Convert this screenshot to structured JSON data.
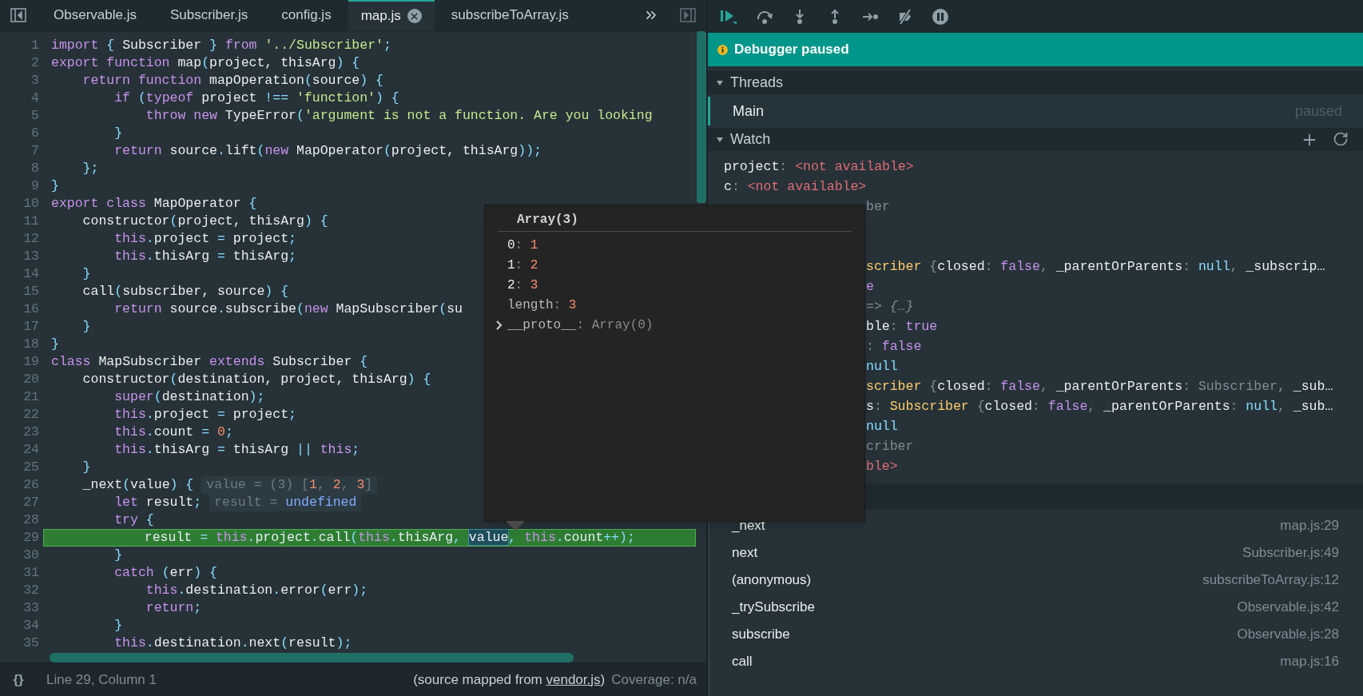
{
  "editor": {
    "tabs": [
      {
        "label": "Observable.js",
        "selected": false
      },
      {
        "label": "Subscriber.js",
        "selected": false
      },
      {
        "label": "config.js",
        "selected": false
      },
      {
        "label": "map.js",
        "selected": true
      },
      {
        "label": "subscribeToArray.js",
        "selected": false
      }
    ],
    "lines": [
      {
        "number": "1",
        "current": false,
        "tokens": [
          {
            "t": "import",
            "kind": "k"
          },
          {
            "t": " { ",
            "kind": "p"
          },
          {
            "t": "Subscriber",
            "kind": "i"
          },
          {
            "t": " } ",
            "kind": "p"
          },
          {
            "t": "from ",
            "kind": "k"
          },
          {
            "t": "'../Subscriber'",
            "kind": "s"
          },
          {
            "t": ";",
            "kind": "p"
          }
        ]
      },
      {
        "number": "2",
        "current": false,
        "tokens": [
          {
            "t": "export function ",
            "kind": "k"
          },
          {
            "t": "map",
            "kind": "i"
          },
          {
            "t": "(",
            "kind": "p"
          },
          {
            "t": "project, thisArg",
            "kind": "i"
          },
          {
            "t": ") {",
            "kind": "p"
          }
        ]
      },
      {
        "number": "3",
        "current": false,
        "tokens": [
          {
            "t": "    return function ",
            "kind": "k"
          },
          {
            "t": "mapOperation",
            "kind": "i"
          },
          {
            "t": "(",
            "kind": "p"
          },
          {
            "t": "source",
            "kind": "i"
          },
          {
            "t": ") {",
            "kind": "p"
          }
        ]
      },
      {
        "number": "4",
        "current": false,
        "tokens": [
          {
            "t": "        if ",
            "kind": "k"
          },
          {
            "t": "(",
            "kind": "p"
          },
          {
            "t": "typeof ",
            "kind": "k"
          },
          {
            "t": "project ",
            "kind": "i"
          },
          {
            "t": "!== ",
            "kind": "p"
          },
          {
            "t": "'function'",
            "kind": "s"
          },
          {
            "t": ") {",
            "kind": "p"
          }
        ]
      },
      {
        "number": "5",
        "current": false,
        "tokens": [
          {
            "t": "            throw new ",
            "kind": "k"
          },
          {
            "t": "TypeError",
            "kind": "i"
          },
          {
            "t": "(",
            "kind": "p"
          },
          {
            "t": "'argument is not a function. Are you looking",
            "kind": "s"
          }
        ]
      },
      {
        "number": "6",
        "current": false,
        "tokens": [
          {
            "t": "        }",
            "kind": "p"
          }
        ]
      },
      {
        "number": "7",
        "current": false,
        "tokens": [
          {
            "t": "        return ",
            "kind": "k"
          },
          {
            "t": "source",
            "kind": "i"
          },
          {
            "t": ".",
            "kind": "p"
          },
          {
            "t": "lift",
            "kind": "i"
          },
          {
            "t": "(",
            "kind": "p"
          },
          {
            "t": "new ",
            "kind": "k"
          },
          {
            "t": "MapOperator",
            "kind": "i"
          },
          {
            "t": "(",
            "kind": "p"
          },
          {
            "t": "project, thisArg",
            "kind": "i"
          },
          {
            "t": "));",
            "kind": "p"
          }
        ]
      },
      {
        "number": "8",
        "current": false,
        "tokens": [
          {
            "t": "    };",
            "kind": "p"
          }
        ]
      },
      {
        "number": "9",
        "current": false,
        "tokens": [
          {
            "t": "}",
            "kind": "p"
          }
        ]
      },
      {
        "number": "10",
        "current": false,
        "tokens": [
          {
            "t": "export class ",
            "kind": "k"
          },
          {
            "t": "MapOperator ",
            "kind": "i"
          },
          {
            "t": "{",
            "kind": "p"
          }
        ]
      },
      {
        "number": "11",
        "current": false,
        "tokens": [
          {
            "t": "    constructor",
            "kind": "i"
          },
          {
            "t": "(",
            "kind": "p"
          },
          {
            "t": "project, thisArg",
            "kind": "i"
          },
          {
            "t": ") {",
            "kind": "p"
          }
        ]
      },
      {
        "number": "12",
        "current": false,
        "tokens": [
          {
            "t": "        this",
            "kind": "k"
          },
          {
            "t": ".",
            "kind": "p"
          },
          {
            "t": "project ",
            "kind": "i"
          },
          {
            "t": "= ",
            "kind": "p"
          },
          {
            "t": "project",
            "kind": "i"
          },
          {
            "t": ";",
            "kind": "p"
          }
        ]
      },
      {
        "number": "13",
        "current": false,
        "tokens": [
          {
            "t": "        this",
            "kind": "k"
          },
          {
            "t": ".",
            "kind": "p"
          },
          {
            "t": "thisArg ",
            "kind": "i"
          },
          {
            "t": "= ",
            "kind": "p"
          },
          {
            "t": "thisArg",
            "kind": "i"
          },
          {
            "t": ";",
            "kind": "p"
          }
        ]
      },
      {
        "number": "14",
        "current": false,
        "tokens": [
          {
            "t": "    }",
            "kind": "p"
          }
        ]
      },
      {
        "number": "15",
        "current": false,
        "tokens": [
          {
            "t": "    call",
            "kind": "i"
          },
          {
            "t": "(",
            "kind": "p"
          },
          {
            "t": "subscriber, source",
            "kind": "i"
          },
          {
            "t": ") {",
            "kind": "p"
          }
        ]
      },
      {
        "number": "16",
        "current": false,
        "tokens": [
          {
            "t": "        return ",
            "kind": "k"
          },
          {
            "t": "source",
            "kind": "i"
          },
          {
            "t": ".",
            "kind": "p"
          },
          {
            "t": "subscribe",
            "kind": "i"
          },
          {
            "t": "(",
            "kind": "p"
          },
          {
            "t": "new ",
            "kind": "k"
          },
          {
            "t": "MapSubscriber",
            "kind": "i"
          },
          {
            "t": "(",
            "kind": "p"
          },
          {
            "t": "su",
            "kind": "i"
          }
        ]
      },
      {
        "number": "17",
        "current": false,
        "tokens": [
          {
            "t": "    }",
            "kind": "p"
          }
        ]
      },
      {
        "number": "18",
        "current": false,
        "tokens": [
          {
            "t": "}",
            "kind": "p"
          }
        ]
      },
      {
        "number": "19",
        "current": false,
        "tokens": [
          {
            "t": "class ",
            "kind": "k"
          },
          {
            "t": "MapSubscriber ",
            "kind": "i"
          },
          {
            "t": "extends ",
            "kind": "k"
          },
          {
            "t": "Subscriber ",
            "kind": "i"
          },
          {
            "t": "{",
            "kind": "p"
          }
        ]
      },
      {
        "number": "20",
        "current": false,
        "tokens": [
          {
            "t": "    constructor",
            "kind": "i"
          },
          {
            "t": "(",
            "kind": "p"
          },
          {
            "t": "destination, project, thisArg",
            "kind": "i"
          },
          {
            "t": ") {",
            "kind": "p"
          }
        ]
      },
      {
        "number": "21",
        "current": false,
        "tokens": [
          {
            "t": "        super",
            "kind": "k"
          },
          {
            "t": "(",
            "kind": "p"
          },
          {
            "t": "destination",
            "kind": "i"
          },
          {
            "t": ");",
            "kind": "p"
          }
        ]
      },
      {
        "number": "22",
        "current": false,
        "tokens": [
          {
            "t": "        this",
            "kind": "k"
          },
          {
            "t": ".",
            "kind": "p"
          },
          {
            "t": "project ",
            "kind": "i"
          },
          {
            "t": "= ",
            "kind": "p"
          },
          {
            "t": "project",
            "kind": "i"
          },
          {
            "t": ";",
            "kind": "p"
          }
        ]
      },
      {
        "number": "23",
        "current": false,
        "tokens": [
          {
            "t": "        this",
            "kind": "k"
          },
          {
            "t": ".",
            "kind": "p"
          },
          {
            "t": "count ",
            "kind": "i"
          },
          {
            "t": "= ",
            "kind": "p"
          },
          {
            "t": "0",
            "kind": "n"
          },
          {
            "t": ";",
            "kind": "p"
          }
        ]
      },
      {
        "number": "24",
        "current": false,
        "tokens": [
          {
            "t": "        this",
            "kind": "k"
          },
          {
            "t": ".",
            "kind": "p"
          },
          {
            "t": "thisArg ",
            "kind": "i"
          },
          {
            "t": "= ",
            "kind": "p"
          },
          {
            "t": "thisArg ",
            "kind": "i"
          },
          {
            "t": "|| ",
            "kind": "p"
          },
          {
            "t": "this",
            "kind": "k"
          },
          {
            "t": ";",
            "kind": "p"
          }
        ]
      },
      {
        "number": "25",
        "current": false,
        "tokens": [
          {
            "t": "    }",
            "kind": "p"
          }
        ]
      },
      {
        "number": "26",
        "current": false,
        "tokens": [
          {
            "t": "    _next",
            "kind": "i"
          },
          {
            "t": "(",
            "kind": "p"
          },
          {
            "t": "value",
            "kind": "i"
          },
          {
            "t": ") {",
            "kind": "p"
          }
        ],
        "inline": [
          {
            "t": "value = (3) [",
            "kind": "g"
          },
          {
            "t": "1",
            "kind": "n"
          },
          {
            "t": ", ",
            "kind": "g"
          },
          {
            "t": "2",
            "kind": "n"
          },
          {
            "t": ", ",
            "kind": "g"
          },
          {
            "t": "3",
            "kind": "n"
          },
          {
            "t": "]",
            "kind": "g"
          }
        ]
      },
      {
        "number": "27",
        "current": false,
        "tokens": [
          {
            "t": "        let ",
            "kind": "k"
          },
          {
            "t": "result",
            "kind": "i"
          },
          {
            "t": ";",
            "kind": "p"
          }
        ],
        "inline": [
          {
            "t": "result = ",
            "kind": "g"
          },
          {
            "t": "undefined",
            "kind": "u"
          }
        ]
      },
      {
        "number": "28",
        "current": false,
        "tokens": [
          {
            "t": "        try ",
            "kind": "k"
          },
          {
            "t": "{",
            "kind": "p"
          }
        ]
      },
      {
        "number": "29",
        "current": true,
        "tokens": [
          {
            "t": "            result ",
            "kind": "i"
          },
          {
            "t": "= ",
            "kind": "p"
          },
          {
            "t": "this",
            "kind": "k"
          },
          {
            "t": ".",
            "kind": "p"
          },
          {
            "t": "project",
            "kind": "i"
          },
          {
            "t": ".",
            "kind": "p"
          },
          {
            "t": "call",
            "kind": "i"
          },
          {
            "t": "(",
            "kind": "p"
          },
          {
            "t": "this",
            "kind": "k"
          },
          {
            "t": ".",
            "kind": "p"
          },
          {
            "t": "thisArg",
            "kind": "i"
          },
          {
            "t": ", ",
            "kind": "p"
          },
          {
            "t": "value",
            "kind": "hl"
          },
          {
            "t": ", ",
            "kind": "p"
          },
          {
            "t": "this",
            "kind": "k"
          },
          {
            "t": ".",
            "kind": "p"
          },
          {
            "t": "count",
            "kind": "i"
          },
          {
            "t": "++);",
            "kind": "p"
          }
        ]
      },
      {
        "number": "30",
        "current": false,
        "tokens": [
          {
            "t": "        }",
            "kind": "p"
          }
        ]
      },
      {
        "number": "31",
        "current": false,
        "tokens": [
          {
            "t": "        catch ",
            "kind": "k"
          },
          {
            "t": "(",
            "kind": "p"
          },
          {
            "t": "err",
            "kind": "i"
          },
          {
            "t": ") {",
            "kind": "p"
          }
        ]
      },
      {
        "number": "32",
        "current": false,
        "tokens": [
          {
            "t": "            this",
            "kind": "k"
          },
          {
            "t": ".",
            "kind": "p"
          },
          {
            "t": "destination",
            "kind": "i"
          },
          {
            "t": ".",
            "kind": "p"
          },
          {
            "t": "error",
            "kind": "i"
          },
          {
            "t": "(",
            "kind": "p"
          },
          {
            "t": "err",
            "kind": "i"
          },
          {
            "t": ");",
            "kind": "p"
          }
        ]
      },
      {
        "number": "33",
        "current": false,
        "tokens": [
          {
            "t": "            return",
            "kind": "k"
          },
          {
            "t": ";",
            "kind": "p"
          }
        ]
      },
      {
        "number": "34",
        "current": false,
        "tokens": [
          {
            "t": "        }",
            "kind": "p"
          }
        ]
      },
      {
        "number": "35",
        "current": false,
        "tokens": [
          {
            "t": "        this",
            "kind": "k"
          },
          {
            "t": ".",
            "kind": "p"
          },
          {
            "t": "destination",
            "kind": "i"
          },
          {
            "t": ".",
            "kind": "p"
          },
          {
            "t": "next",
            "kind": "i"
          },
          {
            "t": "(",
            "kind": "p"
          },
          {
            "t": "result",
            "kind": "i"
          },
          {
            "t": ");",
            "kind": "p"
          }
        ]
      }
    ],
    "status_bar": {
      "format_button": "{}",
      "cursor": "Line 29, Column 1",
      "source_prefix": "(source mapped from ",
      "source_link": "vendor.js",
      "source_suffix": ")",
      "coverage": "Coverage: n/a"
    }
  },
  "popup": {
    "title": "Array(3)",
    "entries": [
      {
        "key": "0",
        "colon": ":",
        "value": "1",
        "kind": "index",
        "expandable": false
      },
      {
        "key": "1",
        "colon": ":",
        "value": "2",
        "kind": "index",
        "expandable": false
      },
      {
        "key": "2",
        "colon": ":",
        "value": "3",
        "kind": "index",
        "expandable": false
      },
      {
        "key": "length",
        "colon": ":",
        "value": "3",
        "kind": "property",
        "expandable": false
      },
      {
        "key": "__proto__",
        "colon": ":",
        "value": "Array(0)",
        "kind": "prototype",
        "expandable": true
      }
    ]
  },
  "debugger": {
    "banner": "Debugger paused",
    "threads": {
      "title": "Threads",
      "expanded": true,
      "items": [
        {
          "name": "Main",
          "status": "paused",
          "selected": true
        }
      ]
    },
    "watch": {
      "title": "Watch",
      "expanded": true,
      "rows": [
        {
          "kind": "entry",
          "tokens": [
            {
              "t": "project",
              "kind": "key"
            },
            {
              "t": ": ",
              "kind": "colon"
            },
            {
              "t": "<not available>",
              "kind": "err"
            }
          ]
        },
        {
          "kind": "entry",
          "tokens": [
            {
              "t": "c",
              "kind": "key"
            },
            {
              "t": ": ",
              "kind": "colon"
            },
            {
              "t": "<not available>",
              "kind": "err"
            }
          ]
        },
        {
          "kind": "partial",
          "tokens": [
            {
              "t": "ber",
              "kind": "dim"
            }
          ]
        },
        {
          "kind": "partial",
          "tokens": [
            {
              "t": "scriber ",
              "kind": "cls"
            },
            {
              "t": "{",
              "kind": "colon"
            },
            {
              "t": "closed",
              "kind": "key"
            },
            {
              "t": ": ",
              "kind": "colon"
            },
            {
              "t": "false",
              "kind": "bool"
            },
            {
              "t": ", ",
              "kind": "colon"
            },
            {
              "t": "_parentOrParents",
              "kind": "key"
            },
            {
              "t": ": ",
              "kind": "colon"
            },
            {
              "t": "null",
              "kind": "nul"
            },
            {
              "t": ", ",
              "kind": "colon"
            },
            {
              "t": "_subscrip…",
              "kind": "key"
            }
          ]
        },
        {
          "kind": "partial",
          "tokens": [
            {
              "t": "e",
              "kind": "bool"
            }
          ]
        },
        {
          "kind": "partial",
          "tokens": [
            {
              "t": "=> {…}",
              "kind": "dimi"
            }
          ]
        },
        {
          "kind": "partial",
          "tokens": [
            {
              "t": "ble",
              "kind": "key"
            },
            {
              "t": ": ",
              "kind": "colon"
            },
            {
              "t": "true",
              "kind": "bool"
            }
          ]
        },
        {
          "kind": "partial",
          "tokens": [
            {
              "t": ": ",
              "kind": "colon"
            },
            {
              "t": "false",
              "kind": "bool"
            }
          ]
        },
        {
          "kind": "partial",
          "tokens": [
            {
              "t": "null",
              "kind": "nul"
            }
          ]
        },
        {
          "kind": "partial",
          "tokens": [
            {
              "t": "scriber ",
              "kind": "cls"
            },
            {
              "t": "{",
              "kind": "colon"
            },
            {
              "t": "closed",
              "kind": "key"
            },
            {
              "t": ": ",
              "kind": "colon"
            },
            {
              "t": "false",
              "kind": "bool"
            },
            {
              "t": ", ",
              "kind": "colon"
            },
            {
              "t": "_parentOrParents",
              "kind": "key"
            },
            {
              "t": ": ",
              "kind": "colon"
            },
            {
              "t": "Subscriber",
              "kind": "dim"
            },
            {
              "t": ", ",
              "kind": "colon"
            },
            {
              "t": "_sub…",
              "kind": "key"
            }
          ]
        },
        {
          "kind": "partial",
          "tokens": [
            {
              "t": "s",
              "kind": "key"
            },
            {
              "t": ": ",
              "kind": "colon"
            },
            {
              "t": "Subscriber ",
              "kind": "cls"
            },
            {
              "t": "{",
              "kind": "colon"
            },
            {
              "t": "closed",
              "kind": "key"
            },
            {
              "t": ": ",
              "kind": "colon"
            },
            {
              "t": "false",
              "kind": "bool"
            },
            {
              "t": ", ",
              "kind": "colon"
            },
            {
              "t": "_parentOrParents",
              "kind": "key"
            },
            {
              "t": ": ",
              "kind": "colon"
            },
            {
              "t": "null",
              "kind": "nul"
            },
            {
              "t": ", ",
              "kind": "colon"
            },
            {
              "t": "_sub…",
              "kind": "key"
            }
          ]
        },
        {
          "kind": "partial",
          "tokens": [
            {
              "t": "null",
              "kind": "nul"
            }
          ]
        },
        {
          "kind": "partial",
          "tokens": [
            {
              "t": "criber",
              "kind": "dim"
            }
          ]
        },
        {
          "kind": "partial",
          "tokens": [
            {
              "t": "ble>",
              "kind": "err"
            }
          ]
        }
      ]
    },
    "call_stack": {
      "frames": [
        {
          "name": "_next",
          "location": "map.js:29"
        },
        {
          "name": "next",
          "location": "Subscriber.js:49"
        },
        {
          "name": "(anonymous)",
          "location": "subscribeToArray.js:12"
        },
        {
          "name": "_trySubscribe",
          "location": "Observable.js:42"
        },
        {
          "name": "subscribe",
          "location": "Observable.js:28"
        },
        {
          "name": "call",
          "location": "map.js:16"
        }
      ]
    }
  }
}
